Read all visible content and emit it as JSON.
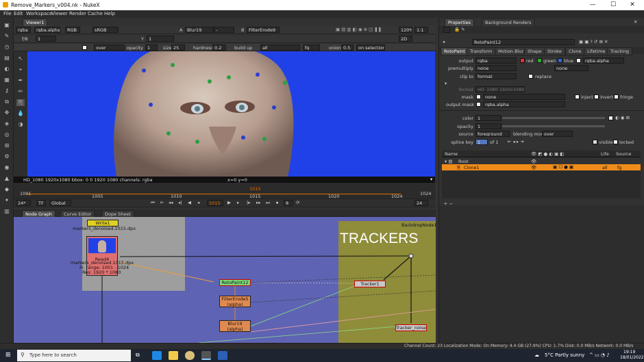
{
  "app": {
    "title": "Remove_Markers_v004.nk - NukeX",
    "minimize": "—",
    "maximize": "☐",
    "close": "✕"
  },
  "menu": [
    "File",
    "Edit",
    "Workspace",
    "Viewer",
    "Render",
    "Cache",
    "Help"
  ],
  "viewer_panel": {
    "tab": "Viewer1",
    "toolbar1": {
      "channels": "rgba",
      "layer": "rgba.alpha",
      "display": "RGB",
      "colorspace": "sRGB",
      "a_label": "A",
      "a_input": "Blur19",
      "dash": "-",
      "b_label": "B",
      "b_input": "FilterErode9",
      "zoom": "120%",
      "ratio": "1:1"
    },
    "toolbar2": {
      "fstop": "f/8",
      "frame_val": "1",
      "y_label": "Y",
      "y_val": "1",
      "view_mode": "2D"
    },
    "toolbar3": {
      "mode": "over",
      "opacity_label": "opacity",
      "opacity": "1",
      "size_label": "size",
      "size": "25",
      "hardness_label": "hardness",
      "hardness": "0.2",
      "buildup": "build up",
      "all": "all",
      "fg": "fg",
      "onion_label": "onion",
      "onion": "0.5",
      "on_selection": "on selection"
    },
    "info_bar": "HD_1080 1920x1080  bbox: 0 0 1920 1080 channels: rgba",
    "coords": "x=0 y=0"
  },
  "timeline": {
    "start": "1001",
    "ticks": [
      "1005",
      "1010",
      "1015",
      "1020",
      "1024"
    ],
    "current": "1015",
    "end": "1024",
    "fps": "24*",
    "tf": "TF",
    "scope": "Global",
    "frame_field": "1015",
    "step": "8",
    "inc": "1",
    "playback_end": "24"
  },
  "graph_panel": {
    "tabs": [
      "Node Graph",
      "Curve Editor",
      "Dope Sheet"
    ],
    "backdrop_title": "BackdropNode1",
    "backdrop_label": "TRACKERS",
    "nodes": {
      "write": "Write1",
      "write_file": "markers_denoised.1015.dpx",
      "read": "Read4",
      "read_file": "markers_denoised.1015.dpx",
      "read_range": "Fr. range: 1001 - 1024",
      "read_res": "Res: 1920 * 1080",
      "roto": "RotoPaint12",
      "erode": "FilterErode5",
      "erode_sub": "(alpha)",
      "blur": "Blur19",
      "blur_sub": "(alpha)",
      "tracker": "Tracker1",
      "tracker_noise": "Tracker_noise"
    }
  },
  "props": {
    "tabs": [
      "Properties",
      "Background Renders"
    ],
    "node_name": "RotoPaint12",
    "subtabs": [
      "RotoPaint",
      "Transform",
      "Motion Blur",
      "Shape",
      "Stroke",
      "Clone",
      "Lifetime",
      "Tracking"
    ],
    "output_label": "output",
    "output": "rgba",
    "red": "red",
    "green": "green",
    "blue": "blue",
    "output_layer": "rgba.alpha",
    "premult_label": "premultiply",
    "premult": "none",
    "premult2": "none",
    "clip_label": "clip to",
    "clip": "format",
    "replace": "replace",
    "format_label": "format",
    "format_val": "HD_1080 1920x1080",
    "mask_label": "mask",
    "mask": "none",
    "inject": "inject",
    "invert": "invert",
    "fringe": "fringe",
    "outmask_label": "output mask",
    "outmask": "rgba.alpha",
    "color_label": "color",
    "color": "1",
    "opacity_label": "opacity",
    "opacity": "1",
    "source_label": "source",
    "source": "foreground",
    "blend_label": "blending mode",
    "blend": "over",
    "spline_label": "spline key",
    "spline_key": "1",
    "spline_of": "of 1",
    "visible": "visible",
    "locked": "locked",
    "tree_headers": {
      "name": "Name",
      "life": "Life",
      "source": "Source"
    },
    "tree": [
      {
        "name": "Root",
        "life": "",
        "source": ""
      },
      {
        "name": "Clone1",
        "life": "all",
        "source": "fg"
      }
    ]
  },
  "status": "Channel Count: 23  Localization Mode: On  Memory: 4.4 GB (27.9%)  CPU: 1.7%  Disk: 0.0 MB/s  Network: 0.0 MB/s",
  "taskbar": {
    "search": "Type here to search",
    "weather": "5°C  Partly sunny",
    "time": "19:19",
    "date": "18/01/2022"
  }
}
